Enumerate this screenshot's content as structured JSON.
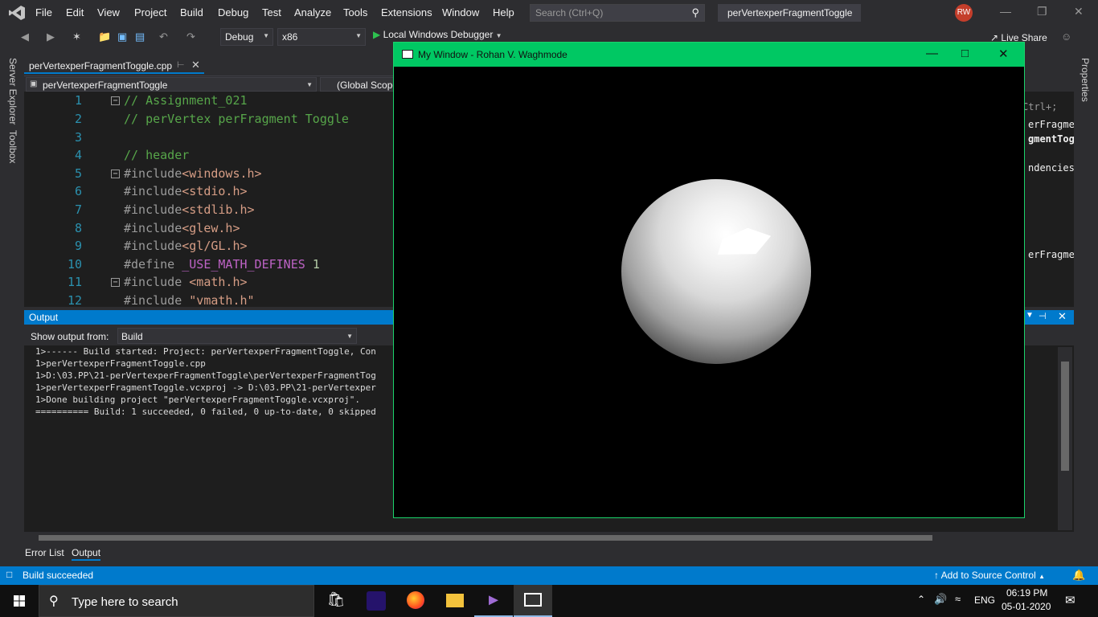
{
  "menu": [
    "File",
    "Edit",
    "View",
    "Project",
    "Build",
    "Debug",
    "Test",
    "Analyze",
    "Tools",
    "Extensions",
    "Window",
    "Help"
  ],
  "search": {
    "placeholder": "Search (Ctrl+Q)"
  },
  "project_name": "perVertexperFragmentToggle",
  "user_initials": "RW",
  "toolbar": {
    "config": "Debug",
    "platform": "x86",
    "run_label": "Local Windows Debugger",
    "live_share": "Live Share"
  },
  "side_tabs": {
    "left": [
      "Server Explorer",
      "Toolbox"
    ],
    "right": [
      "Properties"
    ]
  },
  "document": {
    "tab": "perVertexperFragmentToggle.cpp",
    "nav_scope": "perVertexperFragmentToggle",
    "nav_member": "(Global Scope)"
  },
  "code_lines": [
    {
      "n": "1",
      "text": "// Assignment_021"
    },
    {
      "n": "2",
      "text": "// perVertex perFragment Toggle"
    },
    {
      "n": "3",
      "text": ""
    },
    {
      "n": "4",
      "text": "// header"
    },
    {
      "n": "5",
      "pre": "#include",
      "arg": "<windows.h>"
    },
    {
      "n": "6",
      "pre": "#include",
      "arg": "<stdio.h>"
    },
    {
      "n": "7",
      "pre": "#include",
      "arg": "<stdlib.h>"
    },
    {
      "n": "8",
      "pre": "#include",
      "arg": "<glew.h>"
    },
    {
      "n": "9",
      "pre": "#include",
      "arg": "<gl/GL.h>"
    },
    {
      "n": "10",
      "pre": "#define",
      "macro": "_USE_MATH_DEFINES",
      "val": "1"
    },
    {
      "n": "11",
      "pre": "#include",
      "arg": "<math.h>"
    },
    {
      "n": "12",
      "pre": "#include",
      "arg": "\"vmath.h\""
    }
  ],
  "output": {
    "title": "Output",
    "show_from_label": "Show output from:",
    "source": "Build",
    "lines": [
      "1>------ Build started: Project: perVertexperFragmentToggle, Con",
      "1>perVertexperFragmentToggle.cpp",
      "1>D:\\03.PP\\21-perVertexperFragmentToggle\\perVertexperFragmentTog",
      "1>perVertexperFragmentToggle.vcxproj -> D:\\03.PP\\21-perVertexper",
      "1>Done building project \"perVertexperFragmentToggle.vcxproj\".",
      "========== Build: 1 succeeded, 0 failed, 0 up-to-date, 0 skipped"
    ]
  },
  "right_panel_fragments": [
    "Ctrl+;",
    "erFragmentT",
    "gmentTog",
    "ndencies",
    "erFragment"
  ],
  "bottom_tabs": [
    "Error List",
    "Output"
  ],
  "status": {
    "text": "Build succeeded",
    "source_control": "Add to Source Control"
  },
  "gl_window": {
    "title": "My Window - Rohan V. Waghmode"
  },
  "taskbar": {
    "search_placeholder": "Type here to search",
    "language": "ENG",
    "time": "06:19 PM",
    "date": "05-01-2020",
    "apps": [
      "store-icon",
      "amazon-music-icon",
      "firefox-icon",
      "file-explorer-icon",
      "visual-studio-icon",
      "opengl-window-icon"
    ]
  }
}
